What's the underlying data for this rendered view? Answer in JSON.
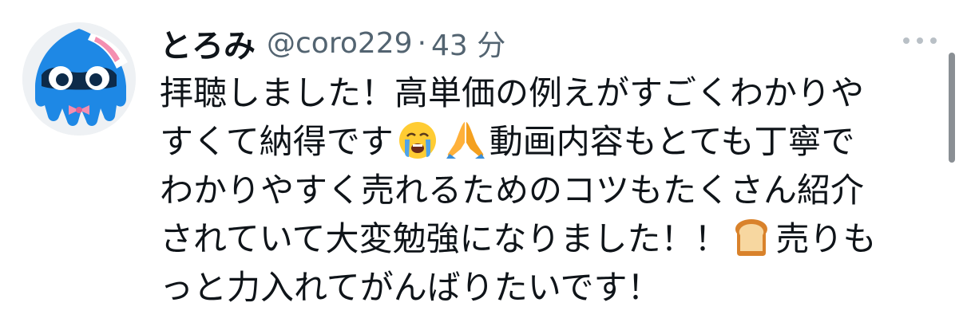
{
  "user": {
    "display_name": "とろみ",
    "handle": "@coro229",
    "separator": "·",
    "time": "43 分"
  },
  "avatar": {
    "icon": "squid-avatar-icon",
    "colors": {
      "body": "#1e88e5",
      "bow": "#f48fb1"
    }
  },
  "more_menu": {
    "icon": "more-horizontal-icon"
  },
  "tweet": {
    "line1": "拝聴しました！高単価の例えがすごくわかりや",
    "line2a": "すくて納得です",
    "line2b": "動画内容もとても丁寧で",
    "line3": "わかりやすく売れるためのコツもたくさん紹介",
    "line4a": "されていて大変勉強になりました！！",
    "line4b": "売りも",
    "line5": "っと力入れてがんばりたいです！",
    "emojis": [
      "crying-face-emoji",
      "folded-hands-emoji",
      "bread-emoji"
    ]
  }
}
